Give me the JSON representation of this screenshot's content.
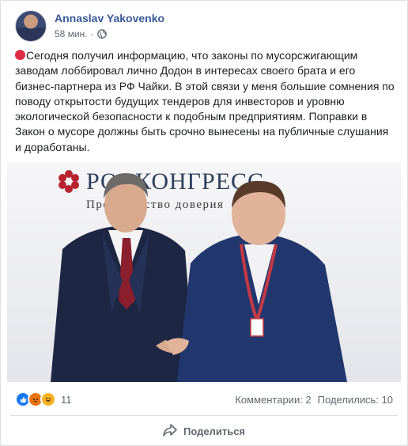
{
  "post": {
    "author": "Annaslav Yakovenko",
    "time": "58 мин.",
    "separator": "·",
    "text": "Сегодня получил информацию, что законы по мусорсжигающим заводам лоббировал лично Додон в интересах своего брата и его бизнес-партнера из РФ Чайки. В этой связи у меня большие сомнения по поводу открытости будущих тендеров для инвесторов и уровню экологической безопасности к подобным предприятиям. Поправки в Закон о мусоре должны быть срочно вынесены на публичные слушания и доработаны."
  },
  "photo": {
    "banner_title": "РОСКОНГРЕСС",
    "banner_subtitle": "Пространство доверия"
  },
  "footer": {
    "reaction_count": "11",
    "comments": "Комментарии: 2",
    "shares": "Поделились: 10",
    "share_label": "Поделиться"
  },
  "colors": {
    "author_link": "#385898",
    "like": "#1877f2",
    "angry": "#e9710f",
    "haha": "#f7b125"
  },
  "icons": [
    "red-circle-icon",
    "globe-icon",
    "like-icon",
    "angry-icon",
    "haha-icon",
    "share-arrow-icon"
  ]
}
